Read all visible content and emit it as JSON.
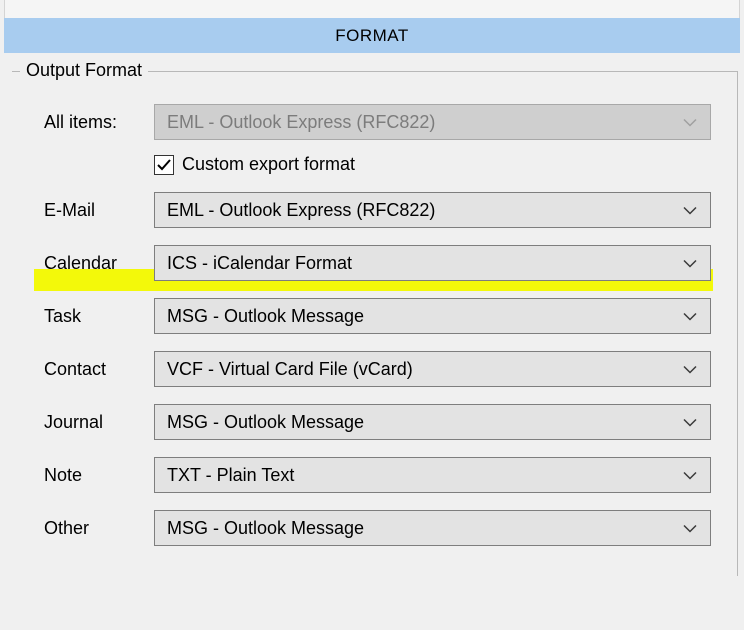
{
  "header": {
    "title": "FORMAT"
  },
  "fieldset": {
    "legend": "Output Format"
  },
  "all_items": {
    "label": "All items:",
    "value": "EML - Outlook Express (RFC822)"
  },
  "checkbox": {
    "label": "Custom export format",
    "checked": true
  },
  "rows": {
    "email": {
      "label": "E-Mail",
      "value": "EML - Outlook Express (RFC822)"
    },
    "calendar": {
      "label": "Calendar",
      "value": "ICS - iCalendar Format"
    },
    "task": {
      "label": "Task",
      "value": "MSG - Outlook Message"
    },
    "contact": {
      "label": "Contact",
      "value": "VCF - Virtual Card File (vCard)"
    },
    "journal": {
      "label": "Journal",
      "value": "MSG - Outlook Message"
    },
    "note": {
      "label": "Note",
      "value": "TXT - Plain Text"
    },
    "other": {
      "label": "Other",
      "value": "MSG - Outlook Message"
    }
  },
  "highlighted_row": "calendar"
}
